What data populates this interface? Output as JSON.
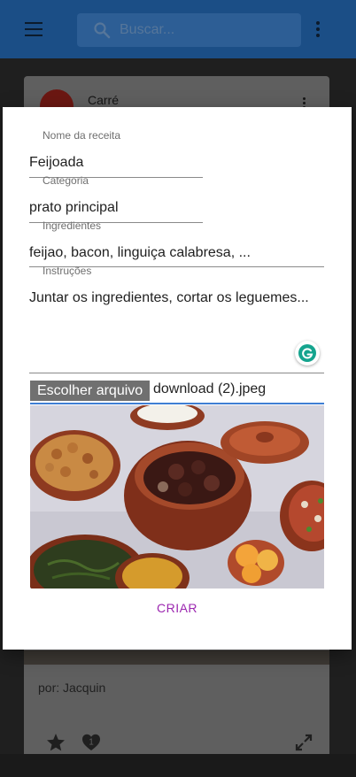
{
  "appbar": {
    "search_placeholder": "Buscar..."
  },
  "background_card": {
    "title": "Carré",
    "author": "por: Jacquin",
    "heart_count": "1"
  },
  "form": {
    "name_label": "Nome da receita",
    "name_value": "Feijoada",
    "category_label": "Categoria",
    "category_value": "prato principal",
    "ingredients_label": "Ingredientes",
    "ingredients_value": "feijao, bacon, linguiça calabresa, ...",
    "instructions_label": "Instruções",
    "instructions_value": "Juntar os ingredientes, cortar os leguemes...",
    "file_button_label": "Escolher arquivo",
    "file_name": "download (2).jpeg",
    "submit_label": "CRIAR"
  },
  "colors": {
    "appbar": "#1b4e86",
    "accent": "#9c27b0",
    "file_underline": "#3f7fd4",
    "grammarly": "#15a48e"
  },
  "icons": [
    "menu-icon",
    "search-icon",
    "more-vert-icon",
    "grammarly-icon",
    "star-icon",
    "heart-icon",
    "expand-icon"
  ]
}
